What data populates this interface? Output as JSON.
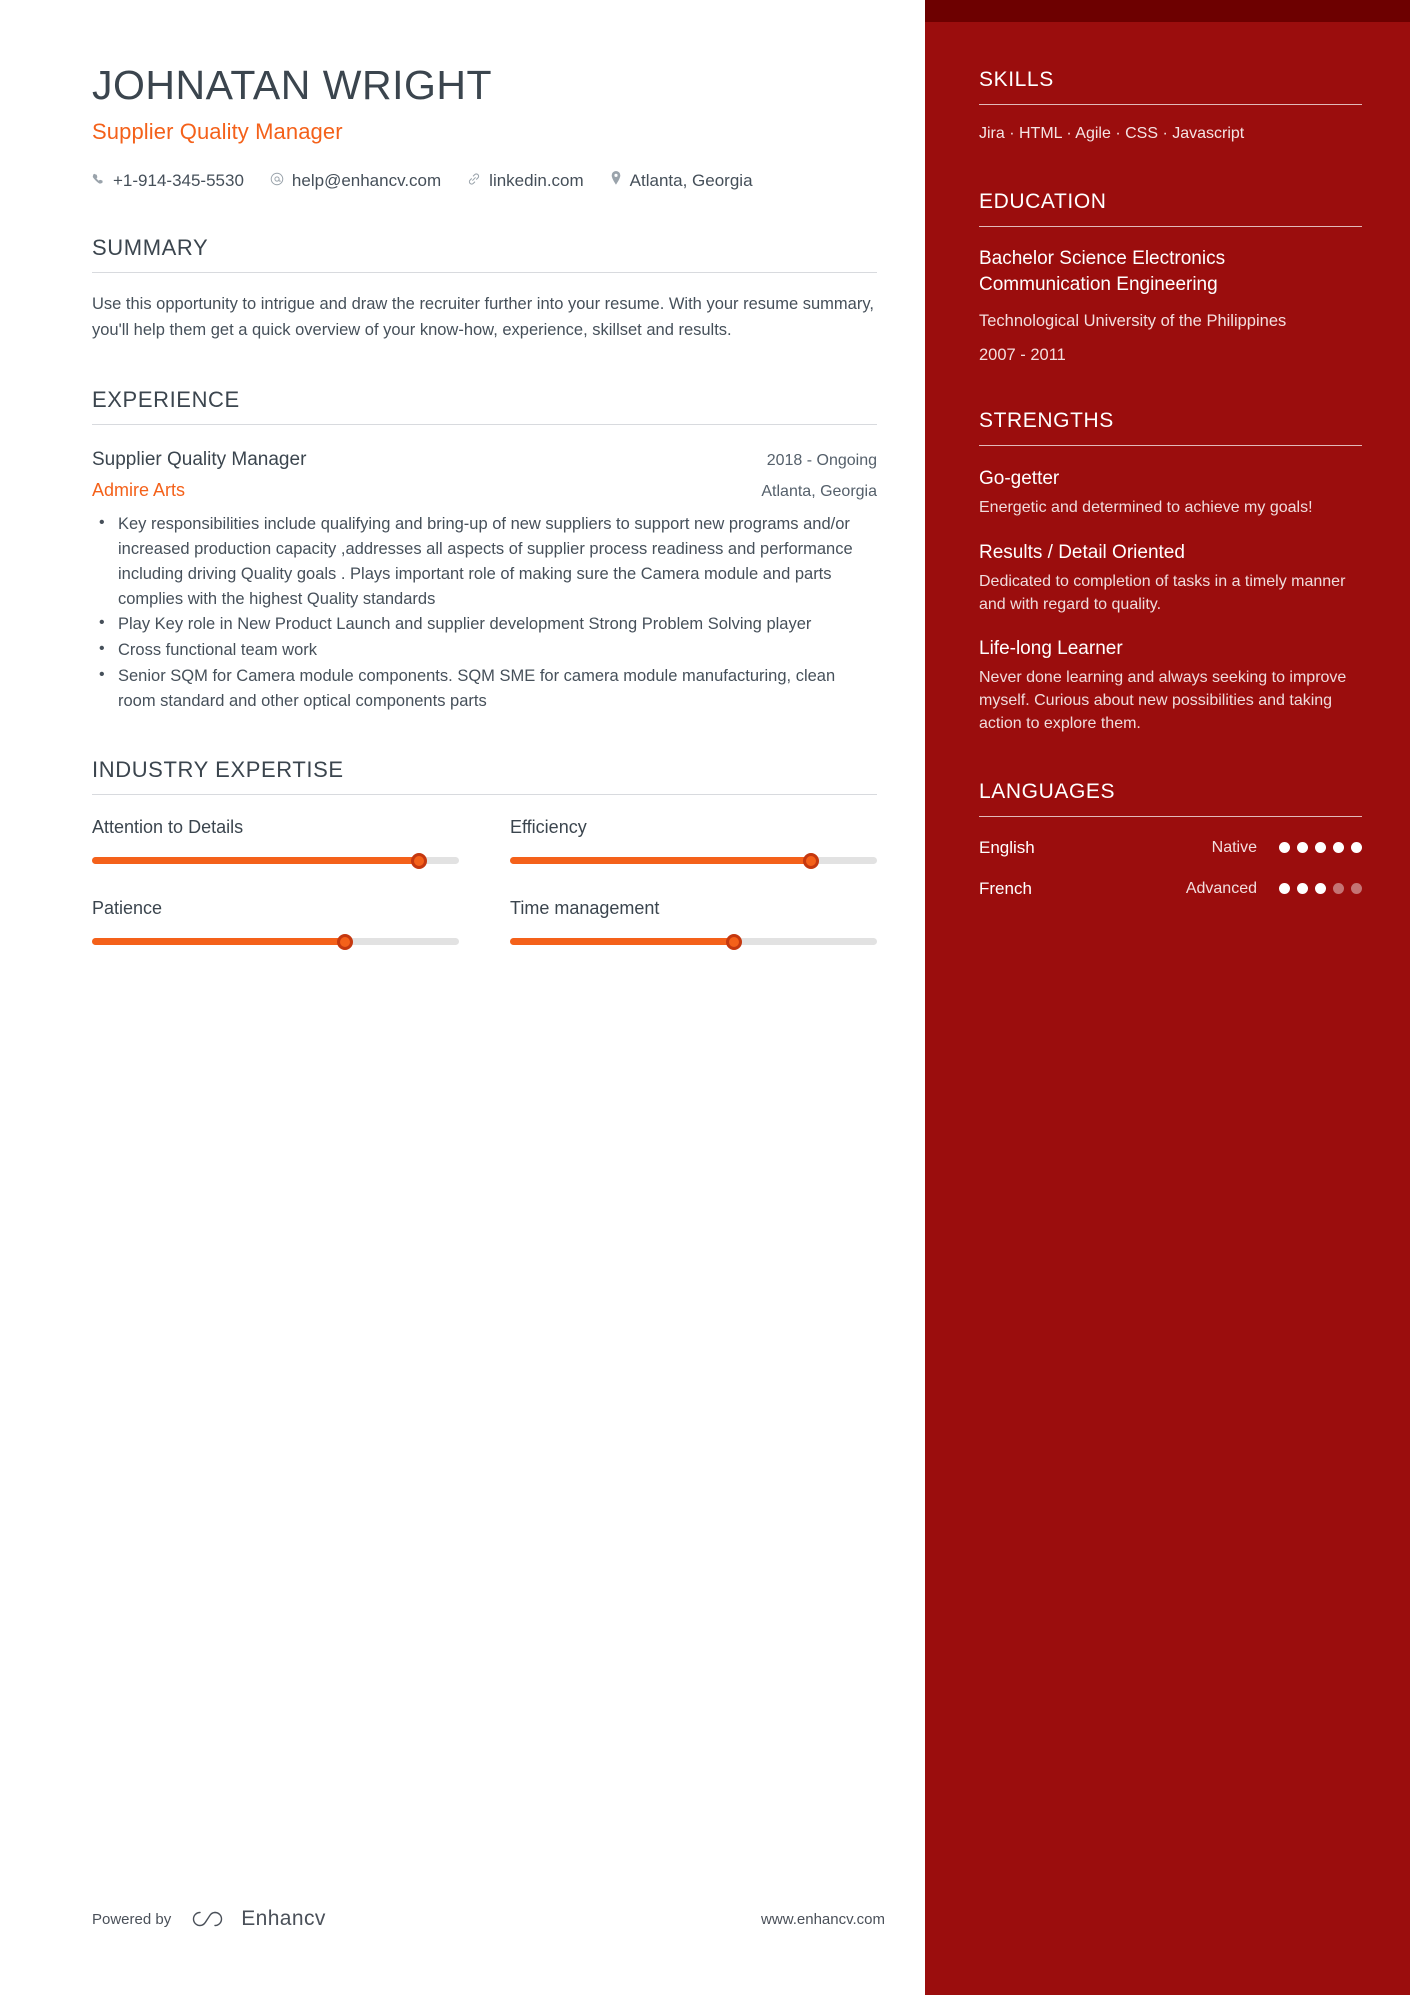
{
  "colors": {
    "accent_orange": "#f4611a",
    "sidebar_red": "#9b0d0d",
    "sidebar_top_strip": "#6d0000",
    "heading_gray": "#3b454e"
  },
  "header": {
    "name": "JOHNATAN WRIGHT",
    "role": "Supplier Quality Manager",
    "contacts": [
      {
        "icon": "phone-icon",
        "text": "+1-914-345-5530"
      },
      {
        "icon": "email-icon",
        "text": "help@enhancv.com"
      },
      {
        "icon": "link-icon",
        "text": "linkedin.com"
      },
      {
        "icon": "location-pin-icon",
        "text": "Atlanta, Georgia"
      }
    ]
  },
  "summary": {
    "title": "SUMMARY",
    "text": "Use this opportunity to intrigue and draw the recruiter further into your resume. With your resume summary, you'll help them get a quick overview of your know-how, experience, skillset and results."
  },
  "experience": {
    "title": "EXPERIENCE",
    "entries": [
      {
        "job_title": "Supplier Quality Manager",
        "date": "2018 - Ongoing",
        "company": "Admire Arts",
        "location": "Atlanta, Georgia",
        "bullets": [
          "Key responsibilities include  qualifying and bring-up of new suppliers to support new programs and/or increased production capacity  ,addresses all aspects of supplier process readiness and performance including driving Quality goals . Plays important role of making sure the Camera module and parts complies with the  highest Quality standards",
          "Play Key role in New Product Launch and supplier development Strong Problem Solving player",
          "Cross functional team work",
          "Senior SQM for Camera module components. SQM SME for camera module manufacturing, clean room standard and other optical components parts"
        ]
      }
    ]
  },
  "industry_expertise": {
    "title": "INDUSTRY EXPERTISE",
    "items": [
      {
        "label": "Attention to Details",
        "percent": 89
      },
      {
        "label": "Efficiency",
        "percent": 82
      },
      {
        "label": "Patience",
        "percent": 69
      },
      {
        "label": "Time management",
        "percent": 61
      }
    ]
  },
  "sidebar": {
    "skills": {
      "title": "SKILLS",
      "list": "Jira · HTML · Agile · CSS · Javascript"
    },
    "education": {
      "title": "EDUCATION",
      "entries": [
        {
          "degree": "Bachelor Science Electronics Communication Engineering",
          "school": "Technological University of the Philippines",
          "date": "2007 - 2011"
        }
      ]
    },
    "strengths": {
      "title": "STRENGTHS",
      "items": [
        {
          "name": "Go-getter",
          "text": "Energetic and determined to achieve my goals!"
        },
        {
          "name": "Results / Detail Oriented",
          "text": "Dedicated to completion of tasks in a timely manner and with regard to quality."
        },
        {
          "name": "Life-long Learner",
          "text": "Never done learning and always seeking to improve myself. Curious about new possibilities and taking action to explore them."
        }
      ]
    },
    "languages": {
      "title": "LANGUAGES",
      "items": [
        {
          "name": "English",
          "level": "Native",
          "filled": 5,
          "total": 5
        },
        {
          "name": "French",
          "level": "Advanced",
          "filled": 3,
          "total": 5
        }
      ]
    }
  },
  "footer": {
    "powered_by": "Powered by",
    "brand": "Enhancv",
    "website": "www.enhancv.com"
  }
}
